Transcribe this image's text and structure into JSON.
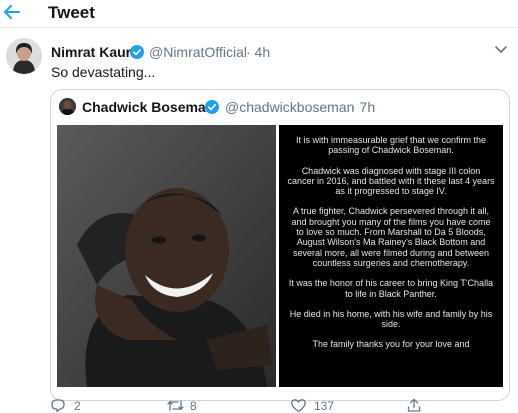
{
  "header": {
    "title": "Tweet",
    "back_icon": "arrow-left-icon"
  },
  "tweet": {
    "author_name": "Nimrat Kaur",
    "handle": "@NimratOfficial",
    "time": "· 4h",
    "text": "So devastating...",
    "verified": true
  },
  "quoted": {
    "author_name": "Chadwick Boseman",
    "handle": "@chadwickboseman",
    "time": "· 7h",
    "verified": true,
    "statement": [
      "It is with immeasurable grief that we confirm the passing of Chadwick Boseman.",
      "Chadwick was diagnosed with stage III colon cancer in 2016, and battled with it these last 4 years as it progressed to stage IV.",
      "A true fighter, Chadwick persevered through it all, and brought you many of the films you have come to love so much. From Marshall to Da 5 Bloods, August Wilson's Ma Rainey's Black Bottom and several more, all were filmed during and between countless surgeries and chemotherapy.",
      "It was the honor of his career to bring King T'Challa to life in Black Panther.",
      "He died in his home, with his wife and family by his side.",
      "The family thanks you for your love and"
    ]
  },
  "actions": {
    "replies": "2",
    "retweets": "8",
    "likes": "137"
  },
  "colors": {
    "accent": "#1da1f2",
    "text": "#14171a",
    "muted": "#657786",
    "border": "#ccd6dd"
  }
}
